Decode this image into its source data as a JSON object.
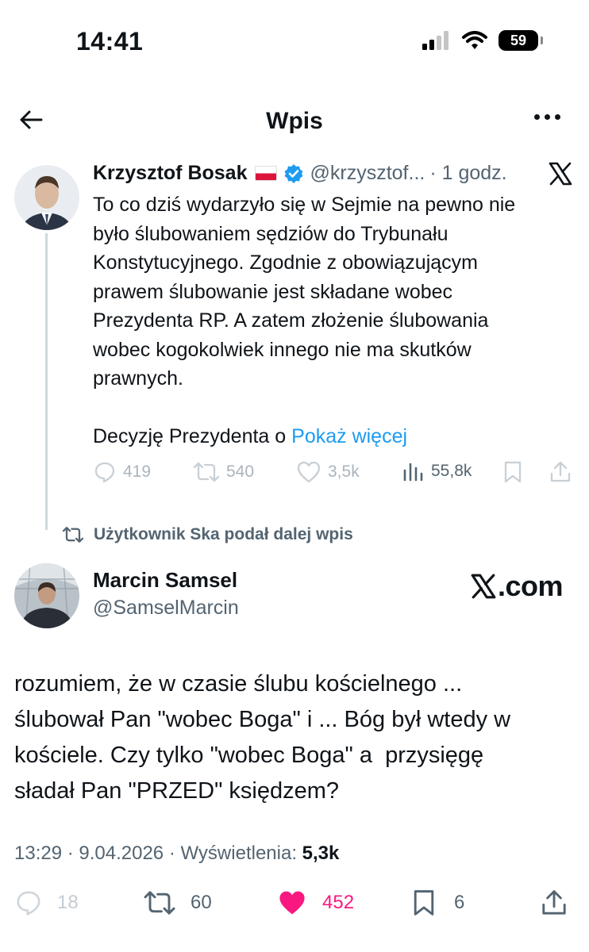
{
  "status_bar": {
    "time": "14:41",
    "battery": "59",
    "icons": [
      "signal-icon",
      "wifi-icon",
      "battery-icon"
    ]
  },
  "nav": {
    "title": "Wpis",
    "back_icon": "back-arrow-icon",
    "more_icon": "more-icon"
  },
  "quoted_tweet": {
    "name": "Krzysztof Bosak",
    "handle": "@krzysztof...",
    "time": "· 1 godz.",
    "lines": [
      "To co dziś wydarzyło się w Sejmie na pewno nie",
      "było ślubowaniem sędziów do Trybunału",
      "Konstytucyjnego. Zgodnie z obowiązującym",
      "prawem ślubowanie jest składane wobec",
      "Prezydenta RP. A zatem złożenie ślubowania",
      "wobec kogokolwiek innego nie ma skutków",
      "prawnych."
    ],
    "last_line": "Decyzję Prezydenta o",
    "show_more": "Pokaż więcej",
    "replies": "419",
    "reposts": "540",
    "likes": "3,5k",
    "views": "55,8k"
  },
  "retweet_label": "Użytkownik Ska podał dalej wpis",
  "main_tweet": {
    "name": "Marcin Samsel",
    "handle": "@SamselMarcin",
    "watermark": ".com",
    "lines": [
      "rozumiem, że w czasie ślubu kościelnego ...",
      "ślubował Pan \"wobec Boga\" i ... Bóg był wtedy w",
      "kościele. Czy tylko \"wobec Boga\" a  przysięgę",
      "sładał Pan \"PRZED\" księdzem?"
    ],
    "timestamp": "13:29 · 9.04.2026 · Wyświetlenia:",
    "views": "5,3k",
    "replies": "18",
    "reposts": "60",
    "likes": "452",
    "bookmarks": "6"
  },
  "colors": {
    "accent": "#1d9bf0",
    "like": "#f91880",
    "muted": "#536471",
    "faded": "#aab4bc",
    "polish_flag_red": "#dc143c"
  }
}
